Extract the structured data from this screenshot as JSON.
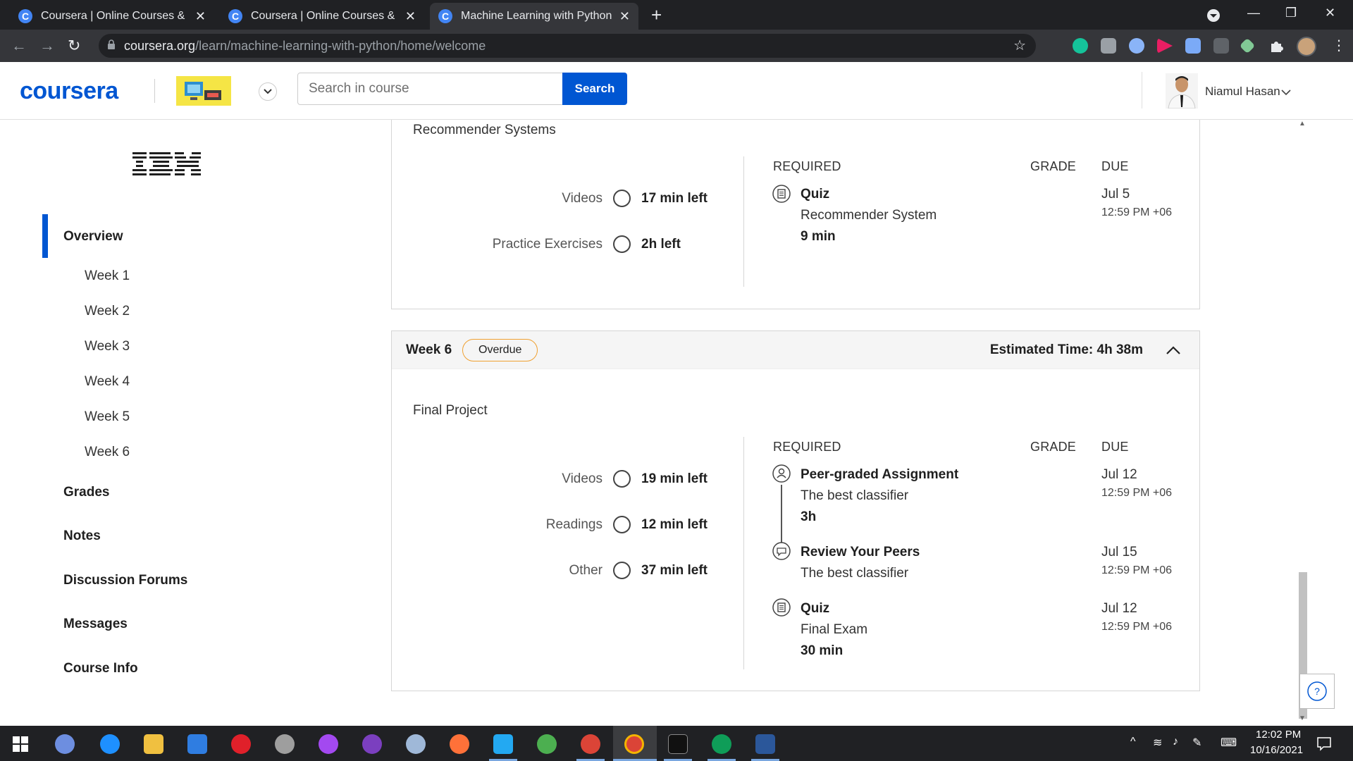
{
  "browser": {
    "tabs": [
      {
        "title": "Coursera | Online Courses & Credentials",
        "favicon": "C"
      },
      {
        "title": "Coursera | Online Courses & Credentials",
        "favicon": "C"
      },
      {
        "title": "Machine Learning with Python - Home",
        "favicon": "C",
        "active": true
      }
    ],
    "url_domain": "coursera.org",
    "url_path": "/learn/machine-learning-with-python/home/welcome",
    "new_tab": "+",
    "window_buttons": {
      "minimize": "—",
      "restore": "❐",
      "close": "✕"
    }
  },
  "header": {
    "logo": "coursera",
    "search_placeholder": "Search in course",
    "search_button": "Search",
    "user_name": "Niamul Hasan"
  },
  "sidebar": {
    "partner_logo": "IBM",
    "items": [
      {
        "label": "Overview",
        "active": true
      },
      {
        "label": "Grades"
      },
      {
        "label": "Notes"
      },
      {
        "label": "Discussion Forums"
      },
      {
        "label": "Messages"
      },
      {
        "label": "Course Info"
      }
    ],
    "weeks": [
      "Week 1",
      "Week 2",
      "Week 3",
      "Week 4",
      "Week 5",
      "Week 6"
    ]
  },
  "module_prev": {
    "title": "Recommender Systems",
    "resources": [
      {
        "label": "Videos",
        "time": "17 min left"
      },
      {
        "label": "Practice Exercises",
        "time": "2h left"
      }
    ],
    "columns": {
      "required": "REQUIRED",
      "grade": "GRADE",
      "due": "DUE"
    },
    "items": [
      {
        "type": "Quiz",
        "name": "Recommender System",
        "duration": "9 min",
        "due_date": "Jul 5",
        "due_time": "12:59 PM +06",
        "icon": "quiz-icon"
      }
    ]
  },
  "week6": {
    "label": "Week 6",
    "status": "Overdue",
    "estimated": "Estimated Time: 4h 38m",
    "module_title": "Final Project",
    "resources": [
      {
        "label": "Videos",
        "time": "19 min left"
      },
      {
        "label": "Readings",
        "time": "12 min left"
      },
      {
        "label": "Other",
        "time": "37 min left"
      }
    ],
    "columns": {
      "required": "REQUIRED",
      "grade": "GRADE",
      "due": "DUE"
    },
    "items": [
      {
        "type": "Peer-graded Assignment",
        "name": "The best classifier",
        "duration": "3h",
        "due_date": "Jul 12",
        "due_time": "12:59 PM +06",
        "icon": "peer-assignment-icon"
      },
      {
        "type": "Review Your Peers",
        "name": "The best classifier",
        "duration": "",
        "due_date": "Jul 15",
        "due_time": "12:59 PM +06",
        "icon": "peer-review-icon"
      },
      {
        "type": "Quiz",
        "name": "Final Exam",
        "duration": "30 min",
        "due_date": "Jul 12",
        "due_time": "12:59 PM +06",
        "icon": "quiz-icon"
      }
    ]
  },
  "help_button": "?",
  "taskbar": {
    "time": "12:02 PM",
    "date": "10/16/2021"
  },
  "colors": {
    "brand": "#0056d2",
    "overdue_border": "#f0a030",
    "chrome_dark": "#202124"
  }
}
